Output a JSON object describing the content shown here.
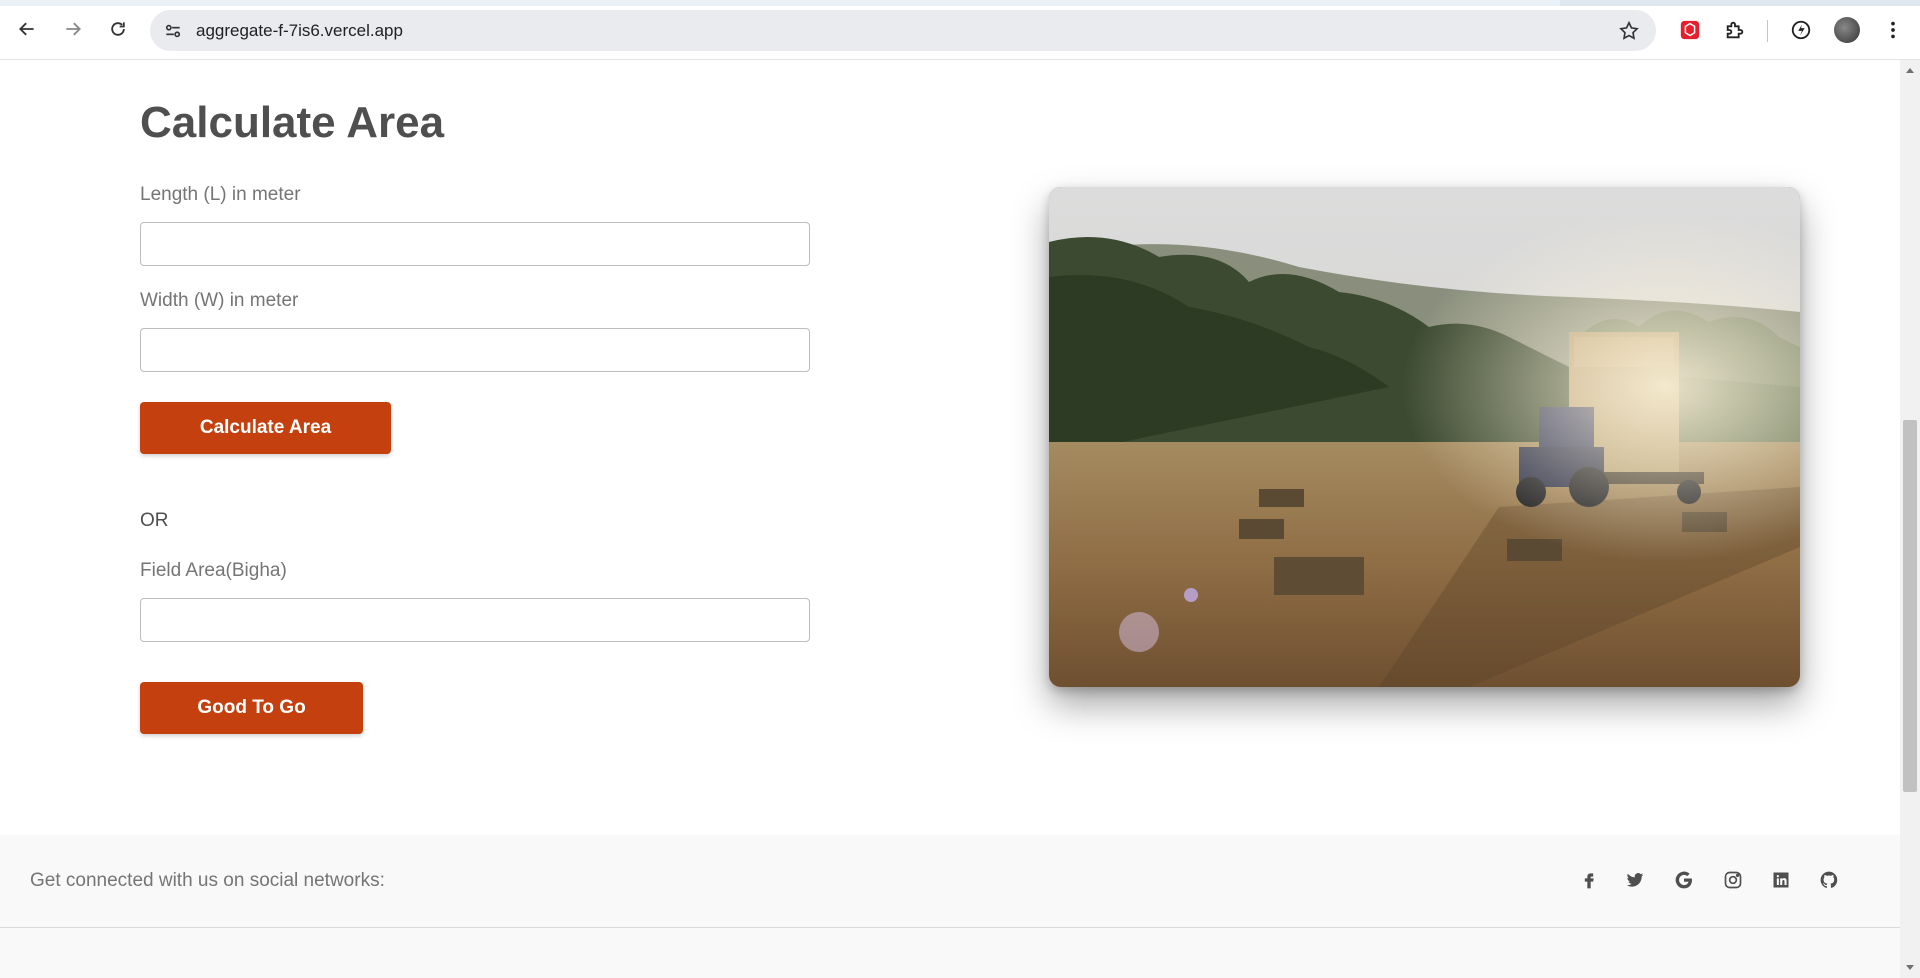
{
  "browser": {
    "url": "aggregate-f-7is6.vercel.app",
    "icons": [
      "back-arrow-icon",
      "forward-arrow-icon",
      "reload-icon",
      "site-info-icon",
      "bookmark-star-icon",
      "extension-icon",
      "puzzle-icon",
      "performance-icon",
      "profile-avatar",
      "kebab-menu-icon"
    ]
  },
  "form": {
    "title": "Calculate Area",
    "length_label": "Length (L) in meter",
    "length_value": "",
    "width_label": "Width (W) in meter",
    "width_value": "",
    "calculate_button": "Calculate Area",
    "or_text": "OR",
    "field_area_label": "Field Area(Bigha)",
    "field_area_value": "",
    "good_button": "Good To Go"
  },
  "image": {
    "description_icon": "farm-field-tractor-hay-photo"
  },
  "footer": {
    "social_text": "Get connected with us on social networks:",
    "icons": [
      "facebook-icon",
      "twitter-icon",
      "google-icon",
      "instagram-icon",
      "linkedin-icon",
      "github-icon"
    ]
  },
  "colors": {
    "accent": "#c4410f",
    "heading": "#4f4f4f",
    "label": "#757575",
    "footer_bg": "#f9f9f9"
  }
}
